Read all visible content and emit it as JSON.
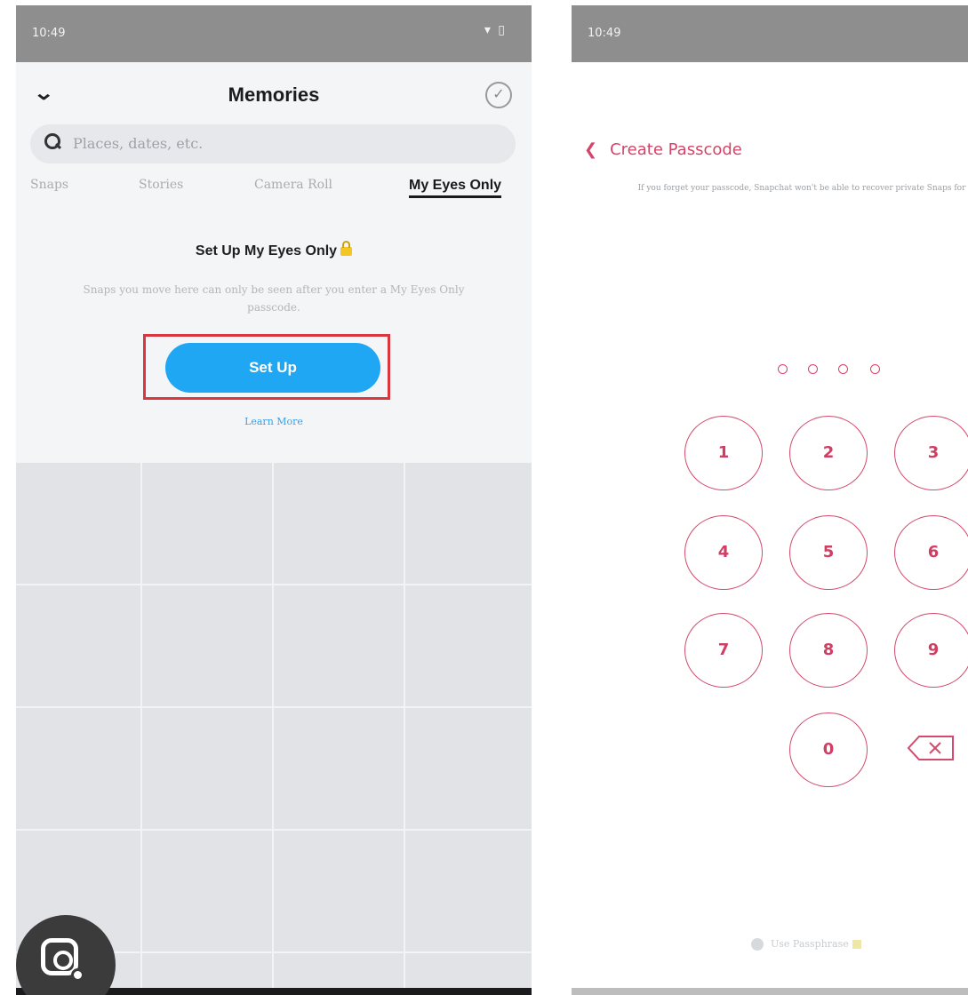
{
  "left_screen": {
    "status": {
      "time": "10:49",
      "system_icons": "▾ ▯"
    },
    "header": {
      "title": "Memories",
      "collapse_icon": "chevron-down-icon",
      "select_icon": "check-circle-icon"
    },
    "search": {
      "placeholder": "Places, dates, etc."
    },
    "tabs": [
      {
        "label": "Snaps",
        "active": false
      },
      {
        "label": "Stories",
        "active": false
      },
      {
        "label": "Camera Roll",
        "active": false
      },
      {
        "label": "My Eyes Only",
        "active": true
      }
    ],
    "setup": {
      "title": "Set Up My Eyes Only",
      "description": "Snaps you move here can only be seen after you enter a My Eyes Only passcode.",
      "button_label": "Set Up",
      "learn_more": "Learn More"
    },
    "highlight_color": "#d9363e",
    "accent_color": "#1fa7f3"
  },
  "right_screen": {
    "status": {
      "time": "10:49"
    },
    "header": {
      "back_label": "Create Passcode"
    },
    "hint": "If you forget your passcode, Snapchat won't be able to recover private Snaps for you.",
    "passcode_length": 4,
    "keypad": {
      "k1": "1",
      "k2": "2",
      "k3": "3",
      "k4": "4",
      "k5": "5",
      "k6": "6",
      "k7": "7",
      "k8": "8",
      "k9": "9",
      "k0": "0"
    },
    "delete_icon": "backspace-icon",
    "passphrase_label": "Use Passphrase",
    "accent_color": "#d4436a"
  },
  "overlay": {
    "lens_icon": "google-lens-icon"
  }
}
